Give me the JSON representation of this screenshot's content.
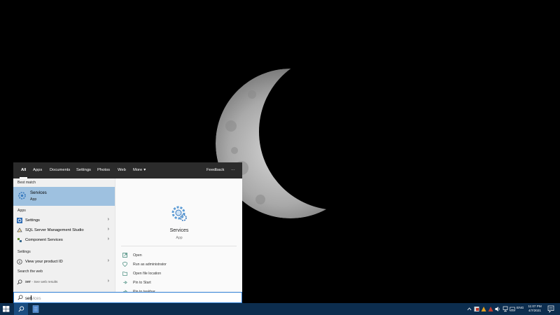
{
  "search_panel": {
    "tabs": [
      {
        "label": "All"
      },
      {
        "label": "Apps"
      },
      {
        "label": "Documents"
      },
      {
        "label": "Settings"
      },
      {
        "label": "Photos"
      },
      {
        "label": "Web"
      },
      {
        "label": "More"
      }
    ],
    "feedback_label": "Feedback",
    "more_options_label": "···",
    "best_match": {
      "section_label": "Best match",
      "name": "Services",
      "type": "App"
    },
    "apps_section_label": "Apps",
    "apps": [
      {
        "label": "Settings"
      },
      {
        "label": "SQL Server Management Studio"
      },
      {
        "label": "Component Services"
      }
    ],
    "settings_section_label": "Settings",
    "settings_items": [
      {
        "label": "View your product ID"
      }
    ],
    "web_section_label": "Search the web",
    "web_result": {
      "query": "ser",
      "suffix": " - See web results"
    },
    "preview": {
      "title": "Services",
      "subtitle": "App",
      "actions": [
        {
          "label": "Open"
        },
        {
          "label": "Run as administrator"
        },
        {
          "label": "Open file location"
        },
        {
          "label": "Pin to Start"
        },
        {
          "label": "Pin to taskbar"
        }
      ]
    },
    "search_box": {
      "typed": "ser",
      "suggestion": "vices"
    }
  },
  "taskbar": {
    "language": "ENG",
    "time": "11:07 PM",
    "date": "4/7/2021",
    "accent_color": "#0c2d4e"
  },
  "colors": {
    "selection_highlight": "#9ec1e0",
    "search_border": "#2f7fd4"
  }
}
